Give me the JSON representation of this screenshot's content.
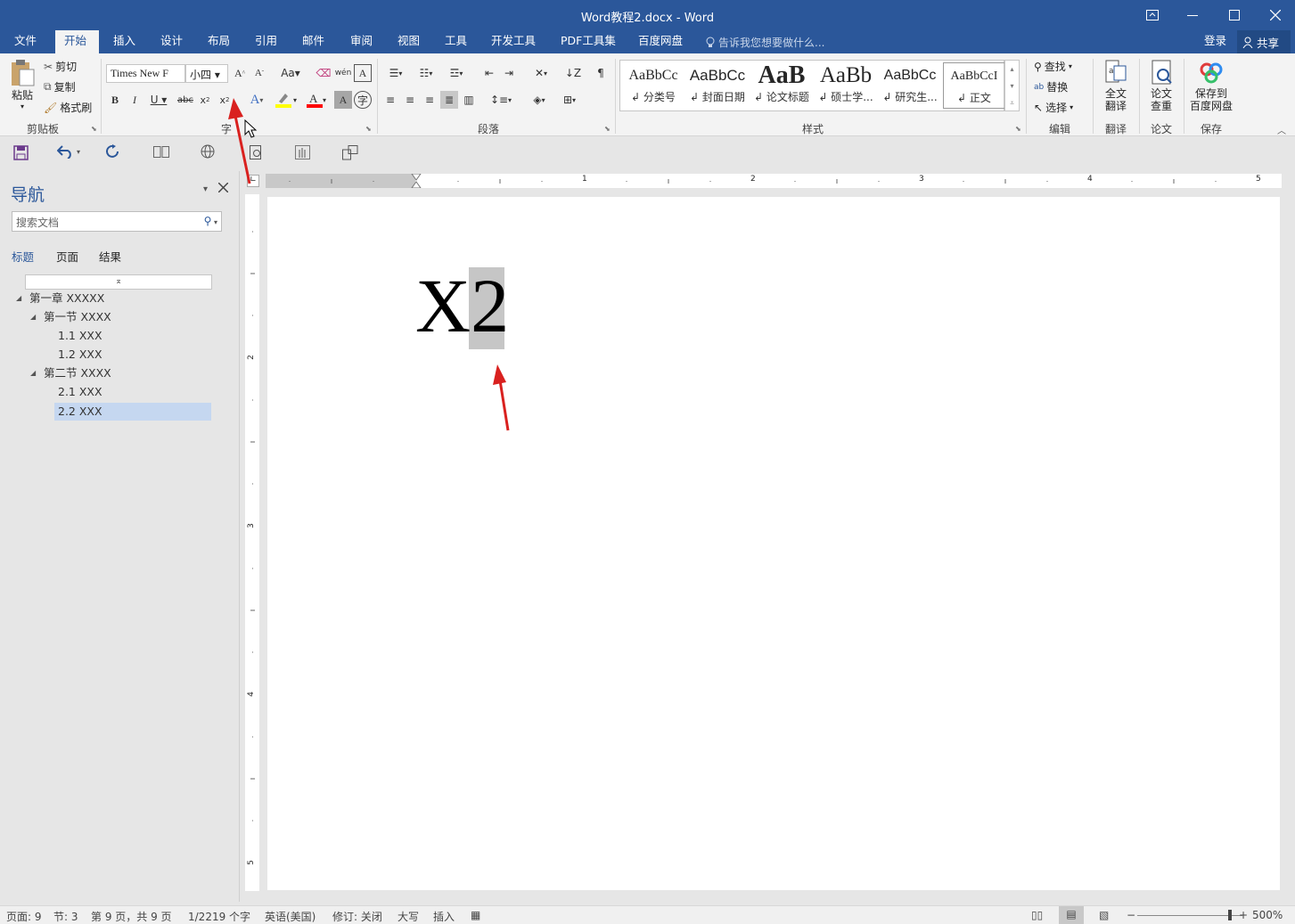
{
  "window": {
    "title": "Word教程2.docx - Word",
    "restore_icon": "ribbon-display-icon"
  },
  "tabs": [
    "文件",
    "开始",
    "插入",
    "设计",
    "布局",
    "引用",
    "邮件",
    "审阅",
    "视图",
    "工具",
    "开发工具",
    "PDF工具集",
    "百度网盘"
  ],
  "active_tab": "开始",
  "tell_me": "告诉我您想要做什么...",
  "account": {
    "login": "登录",
    "share": "共享"
  },
  "clipboard": {
    "paste": "粘贴",
    "cut": "剪切",
    "copy": "复制",
    "format_painter": "格式刷",
    "label": "剪贴板"
  },
  "font": {
    "name": "Times New F",
    "size": "小四",
    "label": "字体",
    "label_visible": "字"
  },
  "paragraph": {
    "label": "段落"
  },
  "styles": {
    "label": "样式",
    "items": [
      {
        "preview": "AaBbCc",
        "name": "分类号"
      },
      {
        "preview": "AaBbCc",
        "name": "封面日期"
      },
      {
        "preview": "AaB",
        "name": "论文标题"
      },
      {
        "preview": "AaBb",
        "name": "硕士学..."
      },
      {
        "preview": "AaBbCc",
        "name": "研究生..."
      },
      {
        "preview": "AaBbCcI",
        "name": "正文"
      }
    ]
  },
  "editing": {
    "find": "查找",
    "replace": "替换",
    "select": "选择",
    "label": "编辑"
  },
  "translate": {
    "btn": "全文\n翻译",
    "label": "翻译"
  },
  "thesis": {
    "btn": "论文\n查重",
    "label": "论文"
  },
  "save": {
    "btn": "保存到\n百度网盘",
    "label": "保存"
  },
  "navigation": {
    "title": "导航",
    "search_placeholder": "搜索文档",
    "tabs": [
      "标题",
      "页面",
      "结果"
    ],
    "tree": [
      {
        "text": "第一章 XXXXX",
        "level": 0,
        "expanded": true
      },
      {
        "text": "第一节 XXXX",
        "level": 1,
        "expanded": true
      },
      {
        "text": "1.1 XXX",
        "level": 2
      },
      {
        "text": "1.2 XXX",
        "level": 2
      },
      {
        "text": "第二节 XXXX",
        "level": 1,
        "expanded": true
      },
      {
        "text": "2.1 XXX",
        "level": 2
      },
      {
        "text": "2.2 XXX",
        "level": 2,
        "selected": true
      }
    ]
  },
  "document": {
    "base": "X",
    "selected_char": "2"
  },
  "ruler_numbers": [
    "1",
    "2",
    "3",
    "4",
    "5"
  ],
  "vruler_numbers": [
    "2",
    "3",
    "4",
    "5"
  ],
  "status": {
    "page": "页面: 9",
    "section": "节: 3",
    "pages": "第 9 页，共 9 页",
    "words": "1/2219 个字",
    "lang": "英语(美国)",
    "track": "修订: 关闭",
    "caps": "大写",
    "insert": "插入",
    "zoom": "500%"
  },
  "colors": {
    "brand": "#2b579a",
    "highlight": "#ffff00",
    "font_color": "#ff0000",
    "annotation": "#d9211f"
  }
}
